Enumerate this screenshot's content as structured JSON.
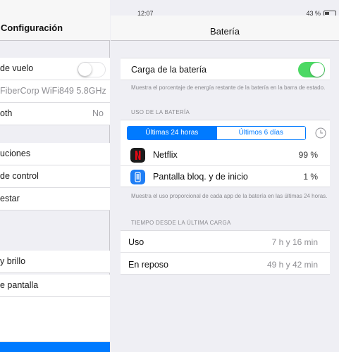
{
  "status_bar": {
    "time": "12:07",
    "battery_percent": "43 %",
    "battery_level": 0.43
  },
  "left": {
    "title": "Configuración",
    "items": [
      {
        "label": "de vuelo",
        "type": "toggle",
        "on": false
      },
      {
        "label": "FiberCorp WiFi849 5.8GHz",
        "type": "value"
      },
      {
        "label": "oth",
        "value": "No"
      },
      {
        "label": "uciones"
      },
      {
        "label": "de control"
      },
      {
        "label": "estar"
      },
      {
        "label": "y brillo"
      },
      {
        "label": "e pantalla"
      }
    ],
    "selected_color": "#007aff"
  },
  "right": {
    "title": "Batería",
    "battery_toggle": {
      "label": "Carga de la batería",
      "on": true,
      "color": "#4cd964"
    },
    "battery_note": "Muestra el porcentaje de energía restante de la batería en la barra de estado.",
    "usage_header": "USO DE LA BATERÍA",
    "segments": [
      {
        "label": "Últimas 24 horas",
        "selected": true
      },
      {
        "label": "Últimos 6 días",
        "selected": false
      }
    ],
    "apps": [
      {
        "name": "Netflix",
        "percent": "99 %",
        "icon": "netflix-icon"
      },
      {
        "name": "Pantalla bloq. y de inicio",
        "percent": "1 %",
        "icon": "home-lock-screen-icon"
      }
    ],
    "usage_note": "Muestra el uso proporcional de cada app de la batería en las últimas 24 horas.",
    "since_header": "TIEMPO DESDE LA ÚLTIMA CARGA",
    "since": [
      {
        "label": "Uso",
        "value": "7 h y 16 min"
      },
      {
        "label": "En reposo",
        "value": "49 h y 42 min"
      }
    ]
  }
}
